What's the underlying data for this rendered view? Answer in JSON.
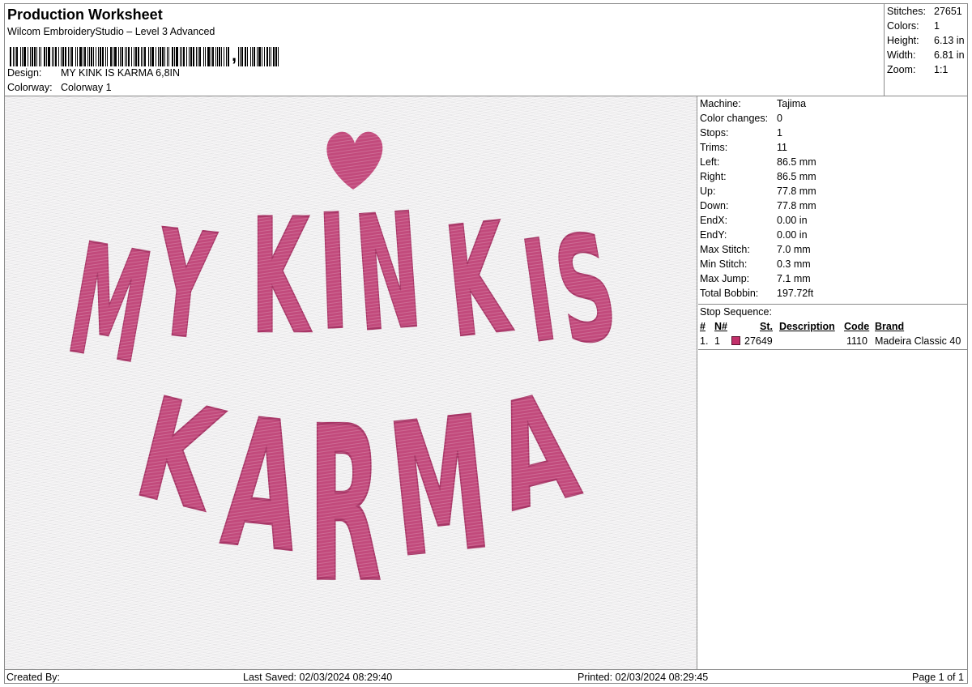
{
  "header": {
    "title": "Production Worksheet",
    "subtitle": "Wilcom EmbroideryStudio – Level 3 Advanced",
    "design_label": "Design:",
    "design_value": "MY KINK IS KARMA 6,8IN",
    "colorway_label": "Colorway:",
    "colorway_value": "Colorway 1"
  },
  "stats": {
    "stitches_label": "Stitches:",
    "stitches_value": "27651",
    "colors_label": "Colors:",
    "colors_value": "1",
    "height_label": "Height:",
    "height_value": "6.13 in",
    "width_label": "Width:",
    "width_value": "6.81 in",
    "zoom_label": "Zoom:",
    "zoom_value": "1:1"
  },
  "info": {
    "rows": [
      {
        "k": "Machine:",
        "v": "Tajima"
      },
      {
        "k": "Color changes:",
        "v": "0"
      },
      {
        "k": "Stops:",
        "v": "1"
      },
      {
        "k": "Trims:",
        "v": "11"
      },
      {
        "k": "Left:",
        "v": "86.5 mm"
      },
      {
        "k": "Right:",
        "v": "86.5 mm"
      },
      {
        "k": "Up:",
        "v": "77.8 mm"
      },
      {
        "k": "Down:",
        "v": "77.8 mm"
      },
      {
        "k": "EndX:",
        "v": "0.00 in"
      },
      {
        "k": "EndY:",
        "v": "0.00 in"
      },
      {
        "k": "Max Stitch:",
        "v": "7.0 mm"
      },
      {
        "k": "Min Stitch:",
        "v": "0.3 mm"
      },
      {
        "k": "Max Jump:",
        "v": "7.1 mm"
      },
      {
        "k": "Total Bobbin:",
        "v": "197.72ft"
      }
    ],
    "stop_sequence_label": "Stop Sequence:",
    "columns": {
      "num": "#",
      "n": "N#",
      "st": "St.",
      "description": "Description",
      "code": "Code",
      "brand": "Brand"
    },
    "sequence": [
      {
        "num": "1.",
        "n": "1",
        "st": "27649",
        "description": "",
        "code": "1110",
        "brand": "Madeira Classic 40",
        "color": "#c2306a"
      }
    ]
  },
  "design": {
    "line1": [
      "M",
      "Y",
      "K",
      "I",
      "N",
      "K",
      "I",
      "S"
    ],
    "line2": [
      "K",
      "A",
      "R",
      "M",
      "A"
    ],
    "thread_color": "#c24a7c",
    "shade_color": "#a83566"
  },
  "footer": {
    "created_by": "Created By:",
    "last_saved": "Last Saved: 02/03/2024 08:29:40",
    "printed": "Printed: 02/03/2024 08:29:45",
    "page": "Page 1 of 1"
  }
}
